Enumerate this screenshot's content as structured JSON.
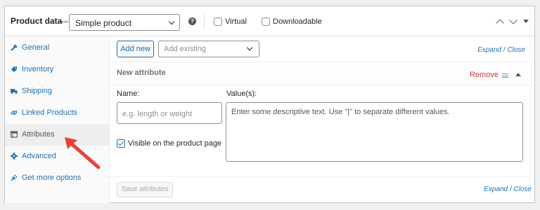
{
  "header": {
    "title": "Product data",
    "dash": "—",
    "product_type": "Simple product",
    "help_glyph": "?",
    "virtual_label": "Virtual",
    "downloadable_label": "Downloadable"
  },
  "sidebar": {
    "items": [
      {
        "label": "General",
        "icon": "wrench-icon"
      },
      {
        "label": "Inventory",
        "icon": "tag-icon"
      },
      {
        "label": "Shipping",
        "icon": "truck-icon"
      },
      {
        "label": "Linked Products",
        "icon": "link-icon"
      },
      {
        "label": "Attributes",
        "icon": "table-icon",
        "active": true
      },
      {
        "label": "Advanced",
        "icon": "gear-icon"
      },
      {
        "label": "Get more options",
        "icon": "plugin-icon"
      }
    ]
  },
  "toolbar": {
    "add_new_label": "Add new",
    "add_existing_placeholder": "Add existing",
    "expand_close": "Expand / Close"
  },
  "attribute": {
    "title": "New attribute",
    "remove_label": "Remove",
    "name_label": "Name:",
    "name_placeholder": "e.g. length or weight",
    "visible_label": "Visible on the product page",
    "visible_checked": true,
    "values_label": "Value(s):",
    "values_placeholder": "Enter some descriptive text. Use \"|\" to separate different values."
  },
  "footer": {
    "save_label": "Save attributes",
    "expand_close": "Expand / Close"
  },
  "colors": {
    "accent": "#2271b1",
    "remove": "#d63638",
    "annotation_arrow": "#e8413c"
  }
}
